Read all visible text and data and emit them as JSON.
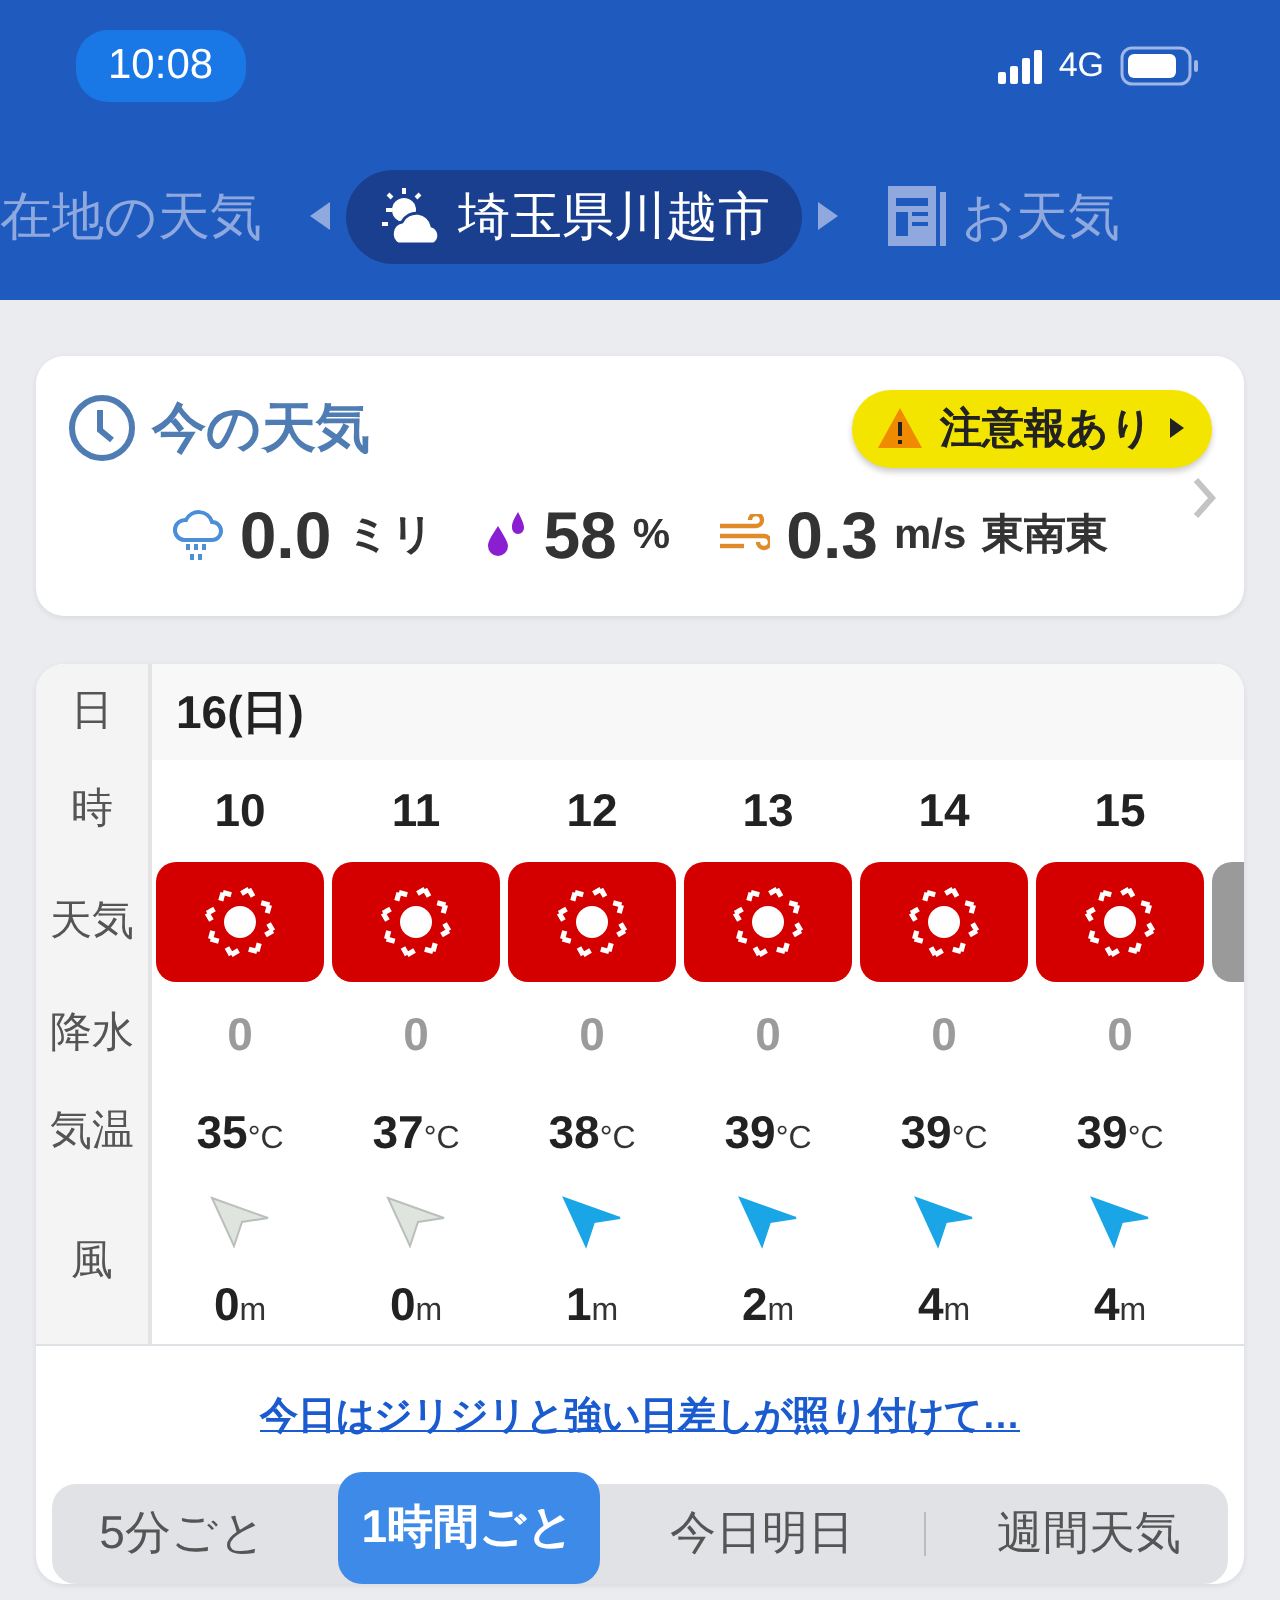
{
  "status_bar": {
    "time": "10:08",
    "network": "4G"
  },
  "locations": [
    {
      "label": "在地の天気",
      "selected": false,
      "kind": "plain"
    },
    {
      "label": "埼玉県川越市",
      "selected": true,
      "kind": "weather"
    },
    {
      "label": "お天気",
      "selected": false,
      "kind": "news"
    }
  ],
  "now": {
    "title": "今の天気",
    "alert": "注意報あり",
    "precipitation": {
      "value": "0.0",
      "unit": "ミリ"
    },
    "humidity": {
      "value": "58",
      "unit": "%"
    },
    "wind": {
      "value": "0.3",
      "unit": "m/s",
      "direction": "東南東"
    }
  },
  "forecast": {
    "row_labels": [
      "日",
      "時",
      "天気",
      "降水",
      "気温",
      "風"
    ],
    "date": "16(日)",
    "hours": [
      {
        "hour": "10",
        "kind": "sunny",
        "precip": "0",
        "temp": "35",
        "temp_unit": "°C",
        "wind": "0",
        "wind_unit": "m",
        "color": "#dfe4df"
      },
      {
        "hour": "11",
        "kind": "sunny",
        "precip": "0",
        "temp": "37",
        "temp_unit": "°C",
        "wind": "0",
        "wind_unit": "m",
        "color": "#dfe4df"
      },
      {
        "hour": "12",
        "kind": "sunny",
        "precip": "0",
        "temp": "38",
        "temp_unit": "°C",
        "wind": "1",
        "wind_unit": "m",
        "color": "#1aa6e6"
      },
      {
        "hour": "13",
        "kind": "sunny",
        "precip": "0",
        "temp": "39",
        "temp_unit": "°C",
        "wind": "2",
        "wind_unit": "m",
        "color": "#1aa6e6"
      },
      {
        "hour": "14",
        "kind": "sunny",
        "precip": "0",
        "temp": "39",
        "temp_unit": "°C",
        "wind": "4",
        "wind_unit": "m",
        "color": "#1aa6e6"
      },
      {
        "hour": "15",
        "kind": "sunny",
        "precip": "0",
        "temp": "39",
        "temp_unit": "°C",
        "wind": "4",
        "wind_unit": "m",
        "color": "#1aa6e6"
      }
    ]
  },
  "comment": "今日はジリジリと強い日差しが照り付けて…",
  "modes": [
    {
      "label": "5分ごと",
      "selected": false
    },
    {
      "label": "1時間ごと",
      "selected": true
    },
    {
      "label": "今日明日",
      "selected": false
    },
    {
      "label": "週間天気",
      "selected": false
    }
  ]
}
